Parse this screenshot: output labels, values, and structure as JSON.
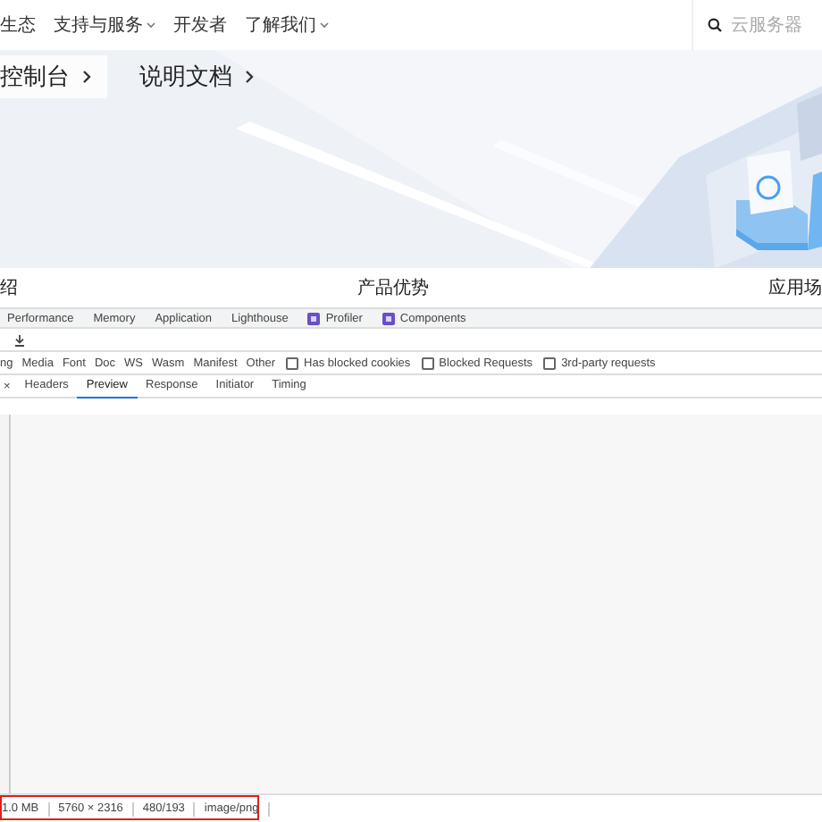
{
  "nav": {
    "items": [
      {
        "label": "生态",
        "dropdown": false
      },
      {
        "label": "支持与服务",
        "dropdown": true
      },
      {
        "label": "开发者",
        "dropdown": false
      },
      {
        "label": "了解我们",
        "dropdown": true
      }
    ],
    "search": {
      "placeholder": "云服务器"
    }
  },
  "hero": {
    "buttons": [
      {
        "label": "控制台",
        "kind": "filled"
      },
      {
        "label": "说明文档",
        "kind": "plain"
      }
    ]
  },
  "section_tabs": [
    "绍",
    "产品优势",
    "应用场"
  ],
  "devtools": {
    "panel_tabs": [
      {
        "label": "Performance",
        "icon": false
      },
      {
        "label": "Memory",
        "icon": false
      },
      {
        "label": "Application",
        "icon": false
      },
      {
        "label": "Lighthouse",
        "icon": false
      },
      {
        "label": "Profiler",
        "icon": true
      },
      {
        "label": "Components",
        "icon": true
      }
    ],
    "filters": [
      {
        "kind": "type",
        "label": "ng"
      },
      {
        "kind": "type",
        "label": "Media"
      },
      {
        "kind": "type",
        "label": "Font"
      },
      {
        "kind": "type",
        "label": "Doc"
      },
      {
        "kind": "type",
        "label": "WS"
      },
      {
        "kind": "type",
        "label": "Wasm"
      },
      {
        "kind": "type",
        "label": "Manifest"
      },
      {
        "kind": "type",
        "label": "Other"
      },
      {
        "kind": "checkbox",
        "label": "Has blocked cookies",
        "checked": false
      },
      {
        "kind": "checkbox",
        "label": "Blocked Requests",
        "checked": false
      },
      {
        "kind": "checkbox",
        "label": "3rd-party requests",
        "checked": false
      }
    ],
    "close": "×",
    "detail_tabs": [
      {
        "label": "Headers",
        "selected": false
      },
      {
        "label": "Preview",
        "selected": true
      },
      {
        "label": "Response",
        "selected": false
      },
      {
        "label": "Initiator",
        "selected": false
      },
      {
        "label": "Timing",
        "selected": false
      }
    ],
    "status": {
      "items": [
        "1.0 MB",
        "5760 × 2316",
        "480/193",
        "image/png"
      ],
      "highlighted": true
    }
  }
}
